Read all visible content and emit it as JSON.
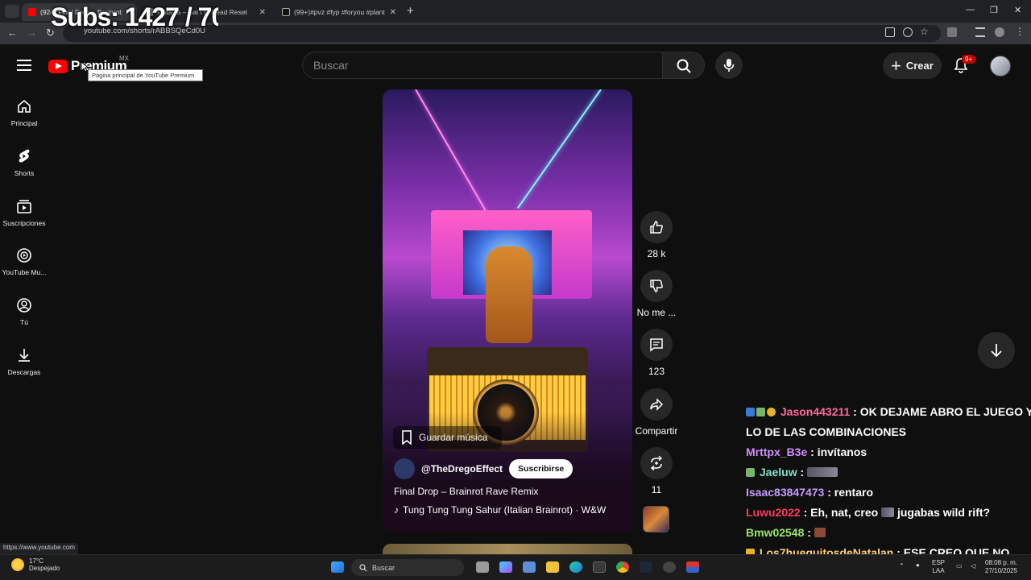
{
  "overlay": {
    "subs_text": "Subs: 1427 / 70"
  },
  "browser": {
    "tabs": [
      {
        "label": "(924) Final Drop – Brainrot"
      },
      {
        "label": "Mutarra – Sal i In Dead Reset"
      },
      {
        "label": "(99+)#pvz #fyp #foryou #plant"
      }
    ],
    "url": "youtube.com/shorts/rABBSQeCd0U",
    "status_url": "https://www.youtube.com"
  },
  "header": {
    "logo_text": "Premium",
    "country": "MX",
    "tooltip": "Página principal de YouTube Premium",
    "search_placeholder": "Buscar",
    "create_label": "Crear",
    "notif_badge": "9+"
  },
  "nav": [
    {
      "label": "Principal",
      "icon": "home-icon"
    },
    {
      "label": "Shorts",
      "icon": "shorts-icon"
    },
    {
      "label": "Suscripciones",
      "icon": "subscriptions-icon"
    },
    {
      "label": "YouTube Mu...",
      "icon": "youtube-music-icon"
    },
    {
      "label": "Tú",
      "icon": "you-icon"
    },
    {
      "label": "Descargas",
      "icon": "download-icon"
    }
  ],
  "video": {
    "save_music": "Guardar música",
    "channel": "@TheDregoEffect",
    "subscribe": "Suscribirse",
    "title": "Final Drop – Brainrot Rave Remix",
    "music": "Tung Tung Tung Sahur (Italian Brainrot) · W&W"
  },
  "actions": {
    "likes": "28 k",
    "dislike": "No me ...",
    "comments": "123",
    "share": "Compartir",
    "remix": "11"
  },
  "chat": [
    {
      "user": "Jason443211",
      "color": "#ff6b9a",
      "msg": " : OK DEJAME ABRO EL JUEGO Y",
      "cont": "LO DE LAS COMBINACIONES"
    },
    {
      "user": "Mrttpx_B3e",
      "color": "#d28cff",
      "msg": " : invítanos"
    },
    {
      "user": "Jaeluw",
      "color": "#7fe0c8",
      "msg": " : "
    },
    {
      "user": "Isaac83847473",
      "color": "#c89cff",
      "msg": " : rentaro"
    },
    {
      "user": "Luwu2022",
      "color": "#ff3a5c",
      "msg": " : Eh, nat, creo ",
      "msg2": " jugabas wild rift?"
    },
    {
      "user": "Bmw02548",
      "color": "#9ae66e",
      "msg": " : "
    },
    {
      "user": "Los7huequitosdeNatalan",
      "color": "#ffd27a",
      "msg": " : ESE CREO QUE NO"
    }
  ],
  "taskbar": {
    "temp": "17°C",
    "weather": "Despejado",
    "search": "Buscar",
    "lang1": "ESP",
    "lang2": "LAA",
    "time": "08:08 p. m.",
    "date": "27/10/2025"
  }
}
